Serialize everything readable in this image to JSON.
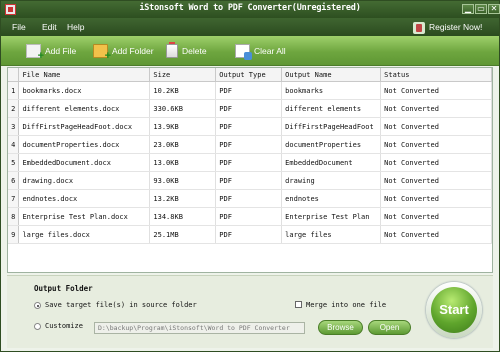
{
  "window": {
    "title": "iStonsoft Word to PDF Converter(Unregistered)"
  },
  "window_controls": {
    "minimize": "▁",
    "maximize": "▭",
    "close": "✕"
  },
  "menu": {
    "items": [
      "File",
      "Edit",
      "Help"
    ],
    "register": "Register Now!"
  },
  "toolbar": {
    "add_file": "Add File",
    "add_folder": "Add Folder",
    "delete": "Delete",
    "clear_all": "Clear All"
  },
  "table": {
    "columns": [
      "File Name",
      "Size",
      "Output Type",
      "Output Name",
      "Status"
    ],
    "rows": [
      {
        "num": "1",
        "file": "bookmarks.docx",
        "size": "10.2KB",
        "type": "PDF",
        "output": "bookmarks",
        "status": "Not Converted"
      },
      {
        "num": "2",
        "file": "different elements.docx",
        "size": "330.6KB",
        "type": "PDF",
        "output": "different elements",
        "status": "Not Converted"
      },
      {
        "num": "3",
        "file": "DiffFirstPageHeadFoot.docx",
        "size": "13.9KB",
        "type": "PDF",
        "output": "DiffFirstPageHeadFoot",
        "status": "Not Converted"
      },
      {
        "num": "4",
        "file": "documentProperties.docx",
        "size": "23.0KB",
        "type": "PDF",
        "output": "documentProperties",
        "status": "Not Converted"
      },
      {
        "num": "5",
        "file": "EmbeddedDocument.docx",
        "size": "13.0KB",
        "type": "PDF",
        "output": "EmbeddedDocument",
        "status": "Not Converted"
      },
      {
        "num": "6",
        "file": "drawing.docx",
        "size": "93.0KB",
        "type": "PDF",
        "output": "drawing",
        "status": "Not Converted"
      },
      {
        "num": "7",
        "file": "endnotes.docx",
        "size": "13.2KB",
        "type": "PDF",
        "output": "endnotes",
        "status": "Not Converted"
      },
      {
        "num": "8",
        "file": "Enterprise Test Plan.docx",
        "size": "134.8KB",
        "type": "PDF",
        "output": "Enterprise Test Plan",
        "status": "Not Converted"
      },
      {
        "num": "9",
        "file": "large files.docx",
        "size": "25.1MB",
        "type": "PDF",
        "output": "large files",
        "status": "Not Converted"
      }
    ]
  },
  "output": {
    "title": "Output Folder",
    "save_source_label": "Save target file(s) in source folder",
    "customize_label": "Customize",
    "merge_label": "Merge into one file",
    "path_value": "D:\\backup\\Program\\iStonsoft\\Word to PDF Converter",
    "browse": "Browse",
    "open": "Open",
    "start": "Start"
  }
}
